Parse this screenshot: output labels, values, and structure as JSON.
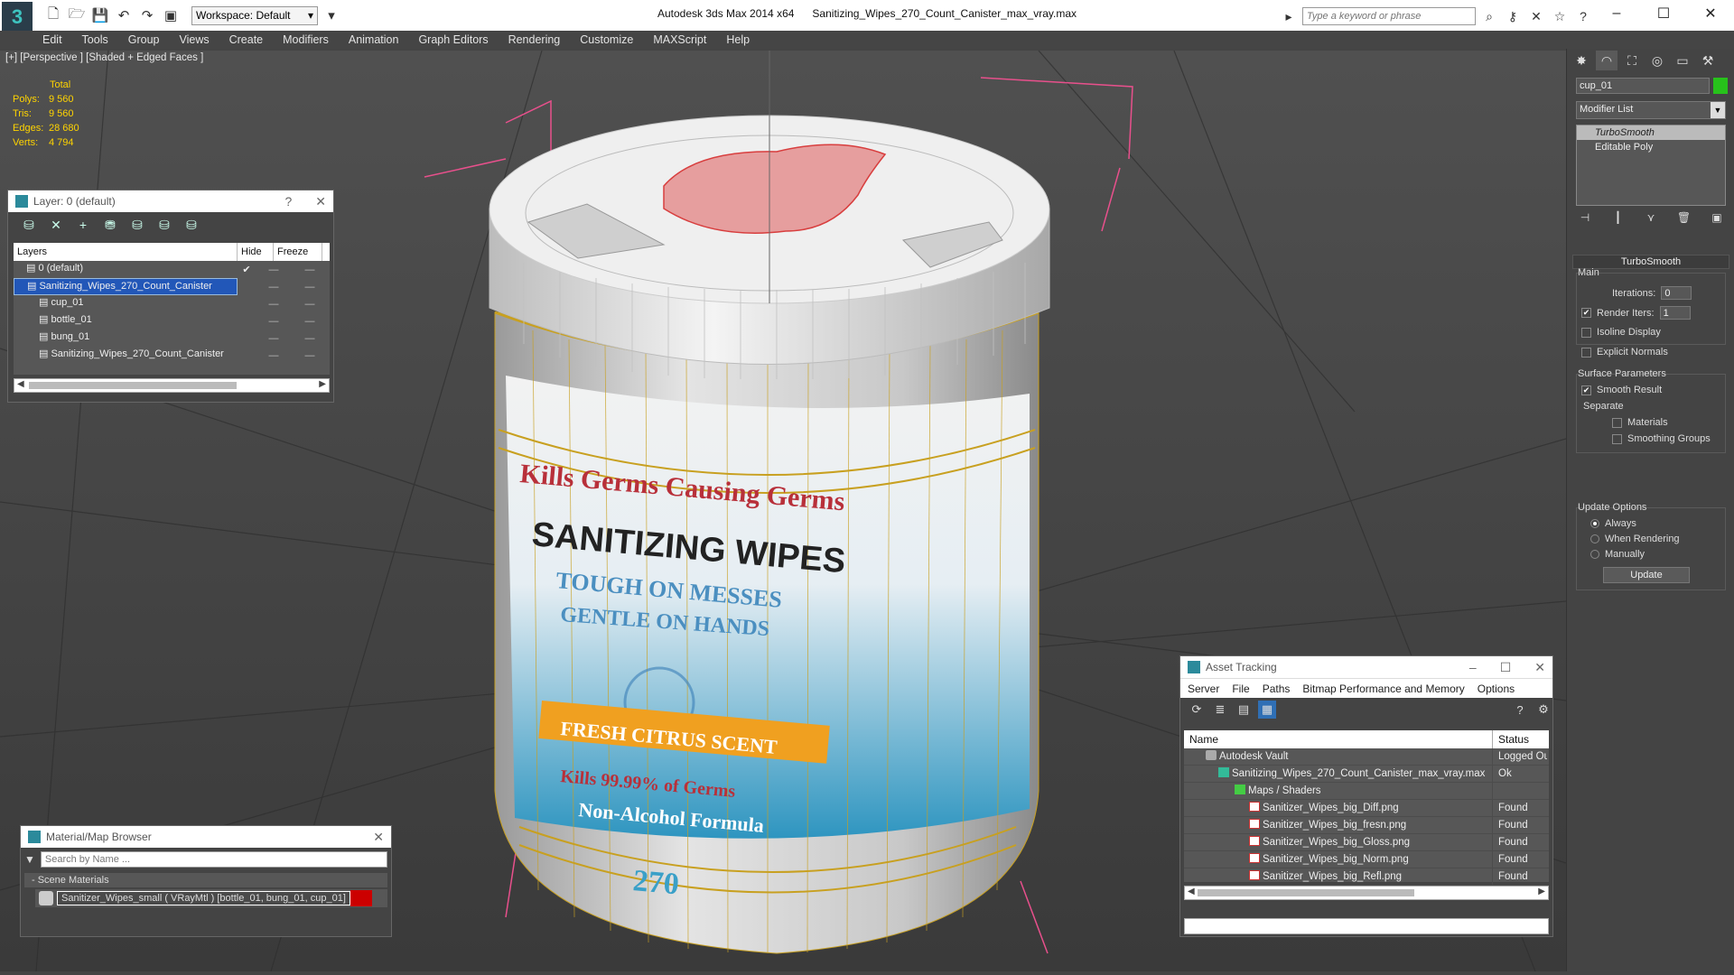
{
  "app": {
    "title": "Autodesk 3ds Max  2014 x64",
    "file": "Sanitizing_Wipes_270_Count_Canister_max_vray.max",
    "workspace": "Workspace: Default",
    "search_placeholder": "Type a keyword or phrase",
    "logo": "3"
  },
  "menu": [
    "Edit",
    "Tools",
    "Group",
    "Views",
    "Create",
    "Modifiers",
    "Animation",
    "Graph Editors",
    "Rendering",
    "Customize",
    "MAXScript",
    "Help"
  ],
  "viewport": {
    "label": "[+] [Perspective ] [Shaded + Edged Faces ]",
    "stats_header": "Total",
    "stats": [
      {
        "k": "Polys:",
        "v": "9 560"
      },
      {
        "k": "Tris:",
        "v": "9 560"
      },
      {
        "k": "Edges:",
        "v": "28 680"
      },
      {
        "k": "Verts:",
        "v": "4 794"
      }
    ],
    "label_lines": [
      "Kills Germs Causing Germs",
      "SANITIZING WIPES",
      "TOUGH ON MESSES",
      "GENTLE ON HANDS",
      "FRESH CITRUS SCENT",
      "Kills 99.99% of Germs",
      "Non-Alcohol Formula",
      "270"
    ],
    "label_colors": {
      "red": "#b8303a",
      "dark": "#222222",
      "blue": "#4b8fc0",
      "orange": "#f0a020",
      "cyan": "#3aa0c8"
    }
  },
  "layer_panel": {
    "title": "Layer: 0 (default)",
    "help": "?",
    "columns": [
      "Layers",
      "Hide",
      "Freeze"
    ],
    "rows": [
      {
        "name": "0 (default)",
        "indent": 0,
        "selected": false,
        "check": "✔"
      },
      {
        "name": "Sanitizing_Wipes_270_Count_Canister",
        "indent": 0,
        "selected": true,
        "check": ""
      },
      {
        "name": "cup_01",
        "indent": 1,
        "selected": false,
        "check": ""
      },
      {
        "name": "bottle_01",
        "indent": 1,
        "selected": false,
        "check": ""
      },
      {
        "name": "bung_01",
        "indent": 1,
        "selected": false,
        "check": ""
      },
      {
        "name": "Sanitizing_Wipes_270_Count_Canister",
        "indent": 1,
        "selected": false,
        "check": ""
      }
    ]
  },
  "material_browser": {
    "title": "Material/Map Browser",
    "search_placeholder": "Search by Name ...",
    "group": "- Scene Materials",
    "item": "Sanitizer_Wipes_small  ( VRayMtl ) [bottle_01, bung_01, cup_01]"
  },
  "asset_tracking": {
    "title": "Asset Tracking",
    "menu": [
      "Server",
      "File",
      "Paths",
      "Bitmap Performance and Memory",
      "Options"
    ],
    "columns": [
      "Name",
      "Status"
    ],
    "rows": [
      {
        "name": "Autodesk Vault",
        "status": "Logged Out",
        "indent": 24,
        "icon": "vault"
      },
      {
        "name": "Sanitizing_Wipes_270_Count_Canister_max_vray.max",
        "status": "Ok",
        "indent": 38,
        "icon": "max"
      },
      {
        "name": "Maps / Shaders",
        "status": "",
        "indent": 56,
        "icon": "folder"
      },
      {
        "name": "Sanitizer_Wipes_big_Diff.png",
        "status": "Found",
        "indent": 72,
        "icon": "png"
      },
      {
        "name": "Sanitizer_Wipes_big_fresn.png",
        "status": "Found",
        "indent": 72,
        "icon": "png"
      },
      {
        "name": "Sanitizer_Wipes_big_Gloss.png",
        "status": "Found",
        "indent": 72,
        "icon": "png"
      },
      {
        "name": "Sanitizer_Wipes_big_Norm.png",
        "status": "Found",
        "indent": 72,
        "icon": "png"
      },
      {
        "name": "Sanitizer_Wipes_big_Refl.png",
        "status": "Found",
        "indent": 72,
        "icon": "png"
      }
    ]
  },
  "command_panel": {
    "object_name": "cup_01",
    "object_color": "#27c21b",
    "modifier_list": "Modifier List",
    "stack": [
      "TurboSmooth",
      "Editable Poly"
    ],
    "rollout": "TurboSmooth",
    "main_label": "Main",
    "iterations_label": "Iterations:",
    "iterations_value": "0",
    "render_iters_label": "Render Iters:",
    "render_iters_value": "1",
    "isoline": "Isoline Display",
    "explicit": "Explicit Normals",
    "surface_label": "Surface Parameters",
    "smooth_result": "Smooth Result",
    "separate_label": "Separate",
    "materials": "Materials",
    "smoothing_groups": "Smoothing Groups",
    "update_label": "Update Options",
    "always": "Always",
    "when_rendering": "When Rendering",
    "manually": "Manually",
    "update_button": "Update"
  }
}
